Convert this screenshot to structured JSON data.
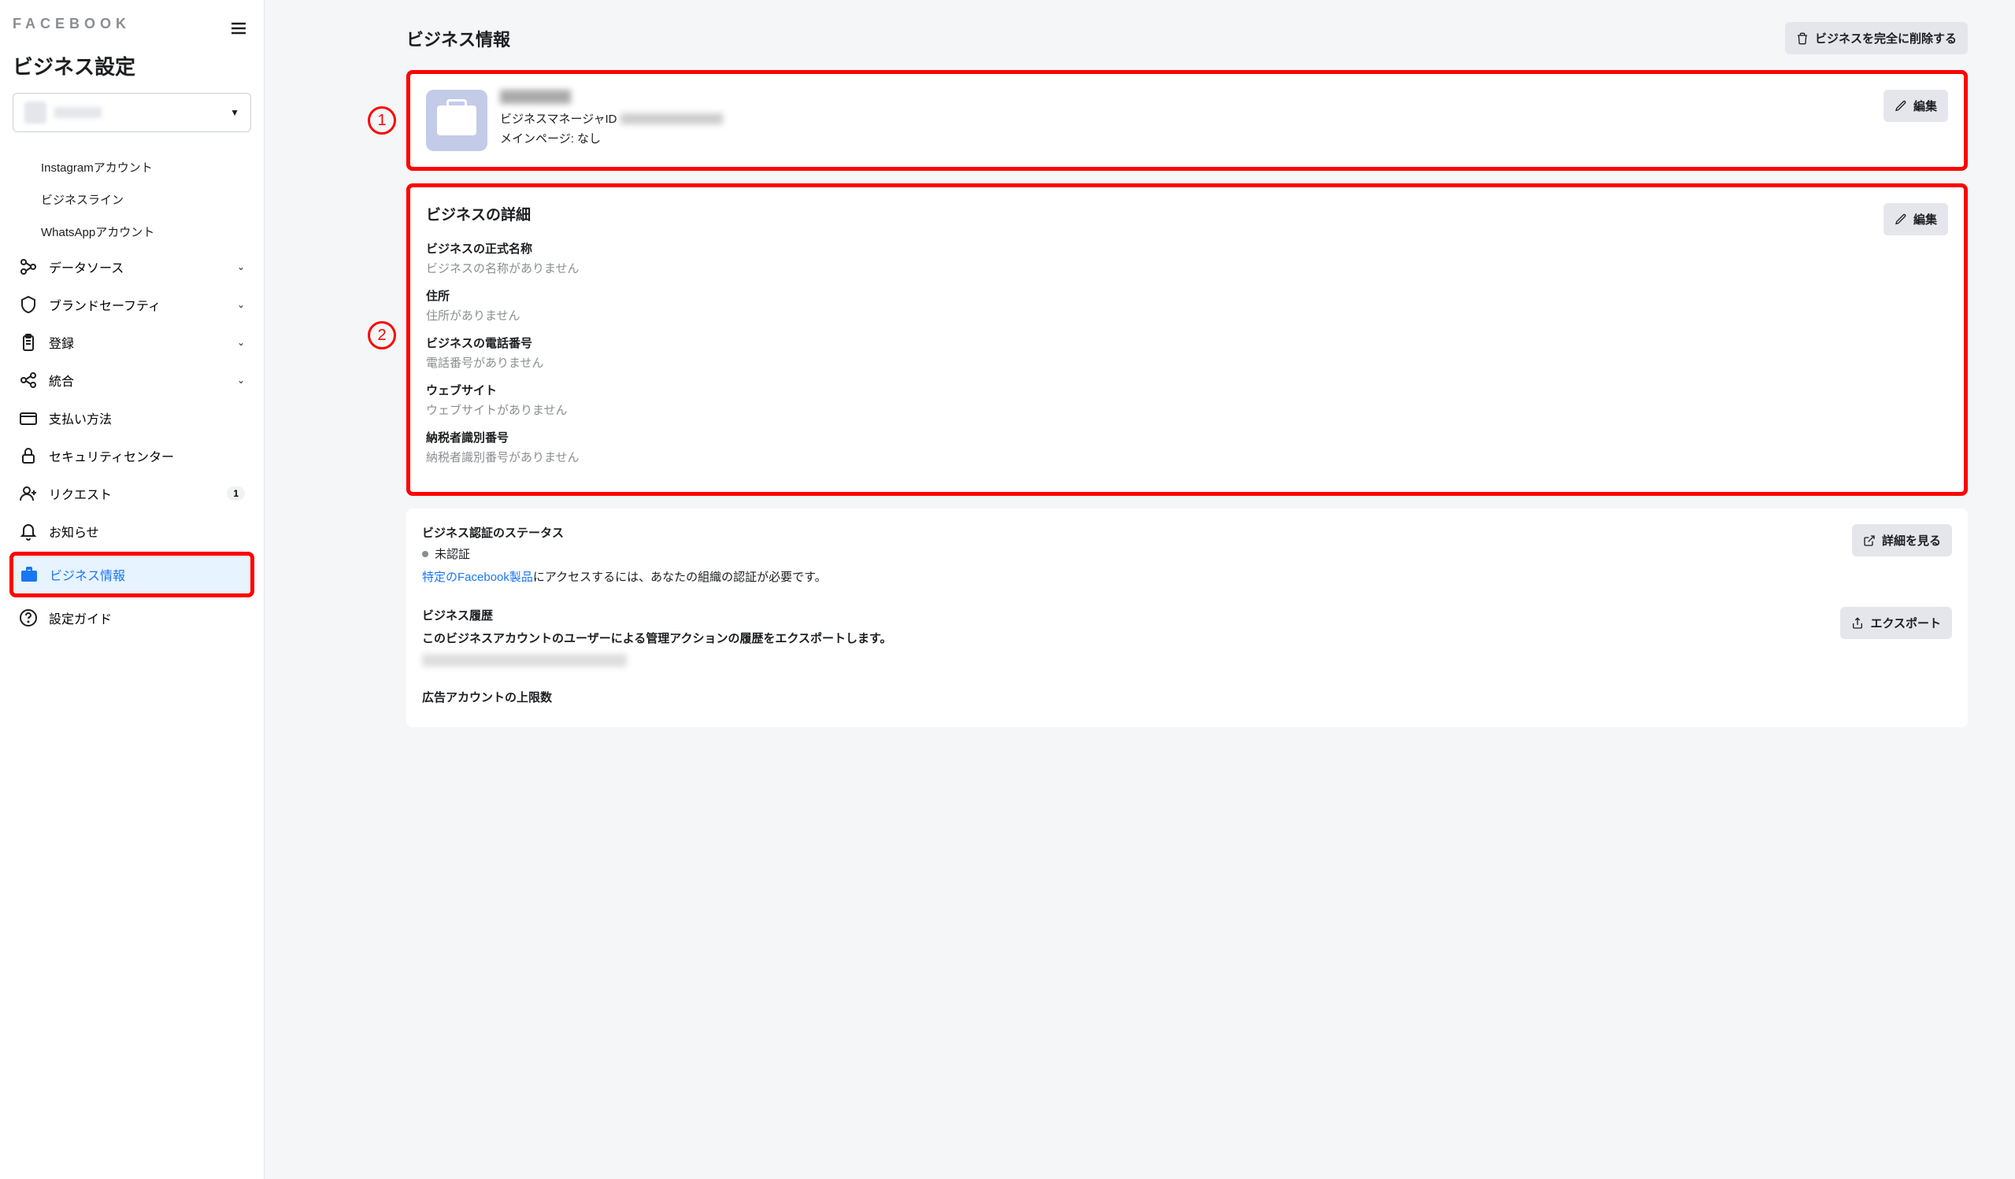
{
  "header": {
    "logo": "FACEBOOK",
    "title": "ビジネス設定"
  },
  "sidebar": {
    "sub_items": [
      {
        "label": "Instagramアカウント"
      },
      {
        "label": "ビジネスライン"
      },
      {
        "label": "WhatsAppアカウント"
      }
    ],
    "items": [
      {
        "label": "データソース",
        "expandable": true
      },
      {
        "label": "ブランドセーフティ",
        "expandable": true
      },
      {
        "label": "登録",
        "expandable": true
      },
      {
        "label": "統合",
        "expandable": true
      },
      {
        "label": "支払い方法",
        "expandable": false
      },
      {
        "label": "セキュリティセンター",
        "expandable": false
      },
      {
        "label": "リクエスト",
        "expandable": false,
        "badge": "1"
      },
      {
        "label": "お知らせ",
        "expandable": false
      },
      {
        "label": "ビジネス情報",
        "expandable": false,
        "active": true
      },
      {
        "label": "設定ガイド",
        "expandable": false
      }
    ]
  },
  "main": {
    "title": "ビジネス情報",
    "delete_btn": "ビジネスを完全に削除する",
    "edit_btn": "編集",
    "biz_id_label": "ビジネスマネージャID",
    "main_page": "メインページ: なし",
    "details_title": "ビジネスの詳細",
    "details": [
      {
        "label": "ビジネスの正式名称",
        "value": "ビジネスの名称がありません"
      },
      {
        "label": "住所",
        "value": "住所がありません"
      },
      {
        "label": "ビジネスの電話番号",
        "value": "電話番号がありません"
      },
      {
        "label": "ウェブサイト",
        "value": "ウェブサイトがありません"
      },
      {
        "label": "納税者識別番号",
        "value": "納税者識別番号がありません"
      }
    ],
    "verification": {
      "title": "ビジネス認証のステータス",
      "status": "未認証",
      "link": "特定のFacebook製品",
      "desc": "にアクセスするには、あなたの組織の認証が必要です。",
      "view_btn": "詳細を見る"
    },
    "history": {
      "title": "ビジネス履歴",
      "desc": "このビジネスアカウントのユーザーによる管理アクションの履歴をエクスポートします。",
      "export_btn": "エクスポート"
    },
    "limit_title": "広告アカウントの上限数"
  },
  "annotations": {
    "n1": "1",
    "n2": "2"
  }
}
